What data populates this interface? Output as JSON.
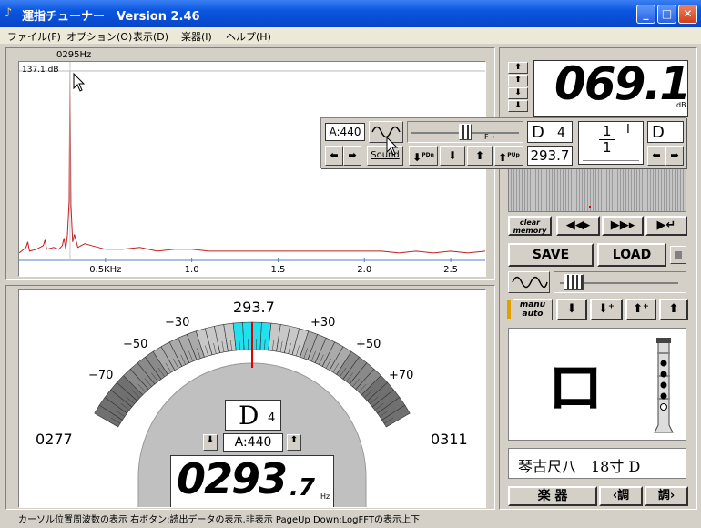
{
  "window": {
    "title": "運指チューナー　Version 2.46"
  },
  "menu": [
    "ファイル(F)",
    "オプション(O)",
    "表示(D)",
    "楽器(I)",
    "ヘルプ(H)"
  ],
  "spectrum": {
    "cursor_freq": "0295Hz",
    "level_label": "137.1 dB",
    "x_ticks": [
      "0.5KHz",
      "1.0",
      "1.5",
      "2.0",
      "2.5"
    ]
  },
  "chart_data": {
    "type": "line",
    "xlabel": "",
    "ylabel": "",
    "x_ticks": [
      0.5,
      1.0,
      1.5,
      2.0,
      2.5
    ],
    "xlim": [
      0.0,
      2.7
    ],
    "series": [
      {
        "x": [
          0.0,
          0.04,
          0.05,
          0.06,
          0.1,
          0.14,
          0.15,
          0.16,
          0.2,
          0.23,
          0.25,
          0.26,
          0.27,
          0.28,
          0.29,
          0.295,
          0.3,
          0.31,
          0.32,
          0.34,
          0.38,
          0.42,
          0.5,
          0.6,
          0.7,
          0.8,
          0.9,
          1.0,
          1.1,
          1.2,
          1.3,
          1.4,
          1.5,
          1.6,
          1.7,
          1.8,
          1.9,
          2.0,
          2.1,
          2.2,
          2.3,
          2.4,
          2.5,
          2.6,
          2.7
        ],
        "y": [
          2,
          5,
          8,
          3,
          4,
          6,
          9,
          4,
          5,
          4,
          6,
          10,
          4,
          12,
          30,
          100,
          28,
          8,
          12,
          5,
          7,
          6,
          4,
          4,
          5,
          3,
          4,
          4,
          3,
          3,
          3,
          3,
          3,
          3,
          3,
          3,
          3,
          3,
          3,
          2,
          3,
          2,
          3,
          2,
          3
        ]
      }
    ]
  },
  "meter": {
    "target_freq": "293.7",
    "low": "0277",
    "high": "0311",
    "scale_labels": [
      "−70",
      "−50",
      "−30",
      "+30",
      "+50",
      "+70"
    ],
    "note_name": "D",
    "octave": "4",
    "a_ref": "A:440",
    "freq_int": "0293",
    "freq_dec": ".7",
    "freq_unit": "Hz",
    "cursor_position": 0.5
  },
  "toolbar_popup": {
    "a_ref": "A:440",
    "sound_label": "Sound",
    "slider_label": "F→",
    "note": "D",
    "octave": "4",
    "freq": "293.7",
    "fraction_top": "1",
    "fraction_mark": "I",
    "fraction_bottom": "1",
    "pdn": "PDn",
    "pup": "PUp"
  },
  "right": {
    "db_value": "069.1",
    "db_unit": "dB",
    "clear_memory": "clear memory",
    "save": "SAVE",
    "load": "LOAD",
    "manu": "manu",
    "auto": "auto",
    "fingering_char": "ロ",
    "instrument": "琴古尺八　18寸 D",
    "gakki": "楽 器",
    "chou_prev": "‹調",
    "chou_next": "調›"
  },
  "status": "カーソル位置周波数の表示  右ボタン:読出データの表示,非表示  PageUp Down:LogFFTの表示上下"
}
